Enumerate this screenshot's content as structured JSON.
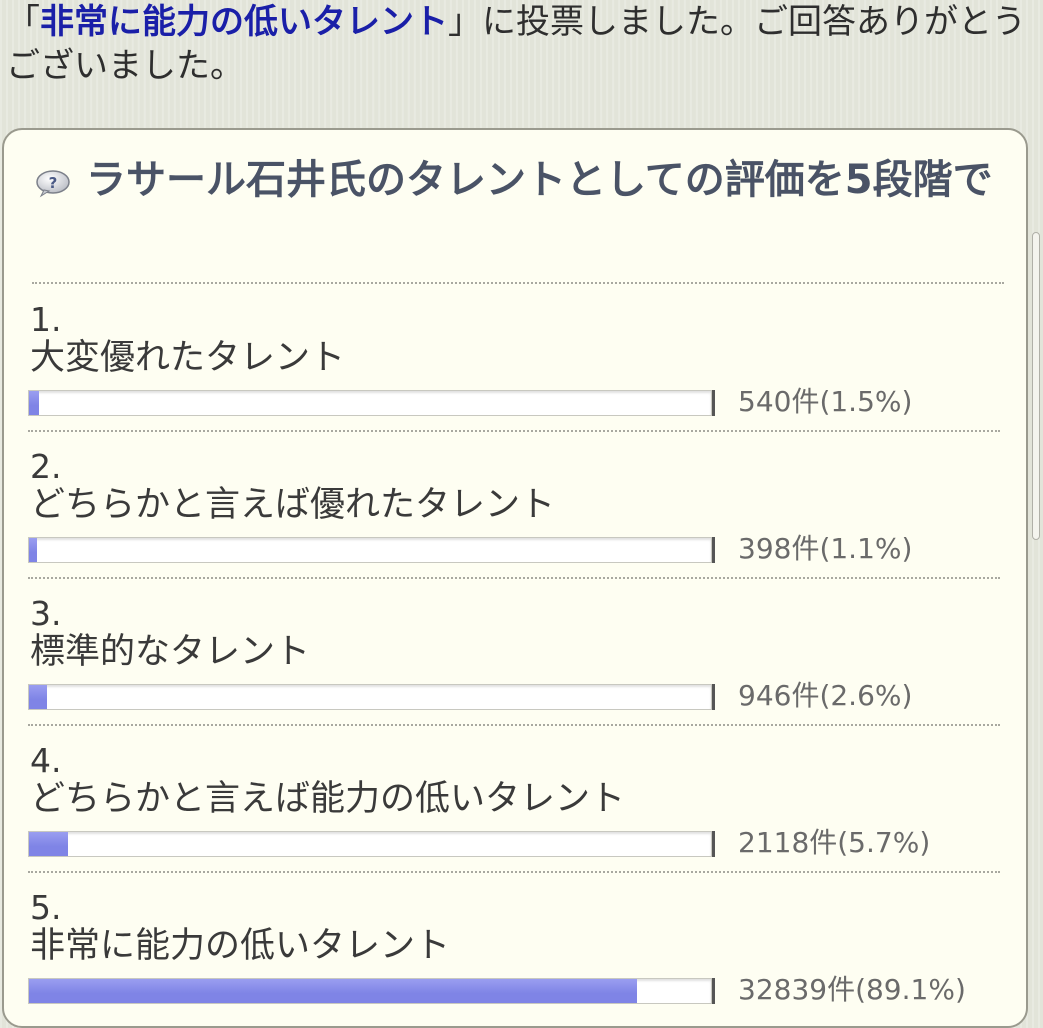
{
  "vote_message": {
    "prefix": "「",
    "choice": "非常に能力の低いタレント",
    "suffix": "」に投票しました。ご回答ありがとうございました。"
  },
  "poll": {
    "title": "ラサール石井氏のタレントとしての評価を5段階で",
    "help_icon": "question-bubble-icon",
    "bar_color": "#7f84e6",
    "options": [
      {
        "number": "1.",
        "label": "大変優れたタレント",
        "count": "540件(1.5%)",
        "percent": 1.5
      },
      {
        "number": "2.",
        "label": "どちらかと言えば優れたタレント",
        "count": "398件(1.1%)",
        "percent": 1.1
      },
      {
        "number": "3.",
        "label": "標準的なタレント",
        "count": "946件(2.6%)",
        "percent": 2.6
      },
      {
        "number": "4.",
        "label": "どちらかと言えば能力の低いタレント",
        "count": "2118件(5.7%)",
        "percent": 5.7
      },
      {
        "number": "5.",
        "label": "非常に能力の低いタレント",
        "count": "32839件(89.1%)",
        "percent": 89.1
      }
    ]
  }
}
